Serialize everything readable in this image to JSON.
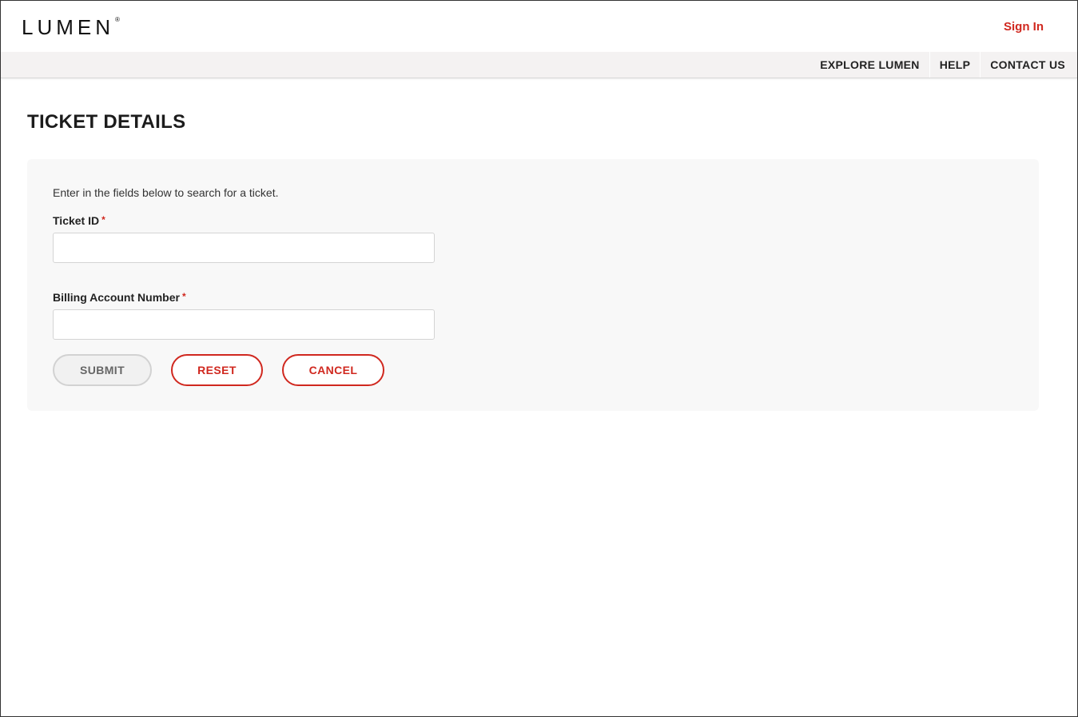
{
  "header": {
    "logo_text": "LUMEN",
    "logo_mark": "®",
    "sign_in_label": "Sign In"
  },
  "nav": {
    "items": [
      {
        "label": "EXPLORE LUMEN"
      },
      {
        "label": "HELP"
      },
      {
        "label": "CONTACT US"
      }
    ]
  },
  "main": {
    "title": "TICKET DETAILS",
    "intro": "Enter in the fields below to search for a ticket.",
    "fields": {
      "ticket_id": {
        "label": "Ticket ID",
        "required_mark": "*",
        "value": "",
        "placeholder": ""
      },
      "billing_account_number": {
        "label": "Billing Account Number",
        "required_mark": "*",
        "value": "",
        "placeholder": ""
      }
    },
    "buttons": {
      "submit": "SUBMIT",
      "reset": "RESET",
      "cancel": "CANCEL"
    }
  },
  "colors": {
    "accent_red": "#d0281f",
    "logo_blue": "#0075c9",
    "panel_bg": "#f8f8f8",
    "nav_bg": "#f4f2f2"
  }
}
